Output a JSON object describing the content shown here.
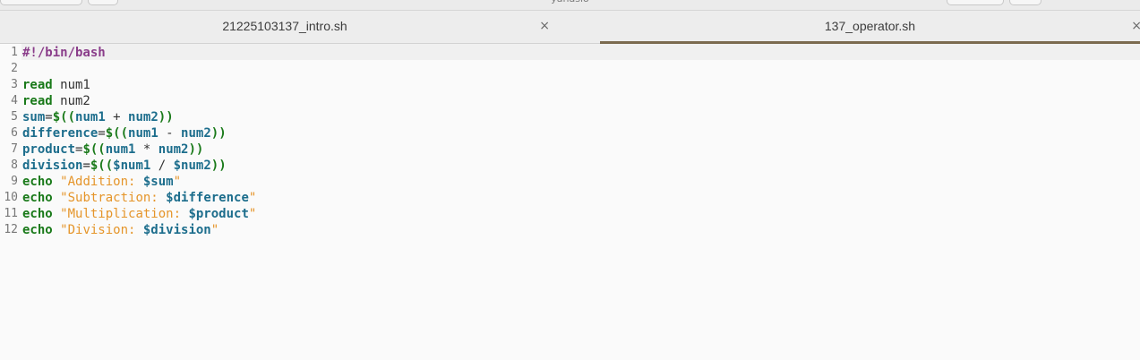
{
  "window": {
    "title": "yanasio"
  },
  "tabs": [
    {
      "label": "21225103137_intro.sh",
      "close": "×"
    },
    {
      "label": "137_operator.sh",
      "close": "×"
    }
  ],
  "colors": {
    "keyword": "#1a7a1a",
    "shebang": "#8a3d8a",
    "variable": "#1c6d8c",
    "string": "#e5952a",
    "active_tab_underline": "#7b6a4f"
  },
  "editor": {
    "line_numbers": [
      "1",
      "2",
      "3",
      "4",
      "5",
      "6",
      "7",
      "8",
      "9",
      "10",
      "11",
      "12"
    ],
    "lines": [
      [
        {
          "t": "shebang",
          "v": "#!/bin/bash"
        }
      ],
      [],
      [
        {
          "t": "kw",
          "v": "read"
        },
        {
          "t": "txt",
          "v": " num1"
        }
      ],
      [
        {
          "t": "kw",
          "v": "read"
        },
        {
          "t": "txt",
          "v": " num2"
        }
      ],
      [
        {
          "t": "var",
          "v": "sum"
        },
        {
          "t": "op",
          "v": "="
        },
        {
          "t": "paren",
          "v": "$(("
        },
        {
          "t": "var",
          "v": "num1"
        },
        {
          "t": "op",
          "v": " + "
        },
        {
          "t": "var",
          "v": "num2"
        },
        {
          "t": "paren",
          "v": "))"
        }
      ],
      [
        {
          "t": "var",
          "v": "difference"
        },
        {
          "t": "op",
          "v": "="
        },
        {
          "t": "paren",
          "v": "$(("
        },
        {
          "t": "var",
          "v": "num1"
        },
        {
          "t": "op",
          "v": " - "
        },
        {
          "t": "var",
          "v": "num2"
        },
        {
          "t": "paren",
          "v": "))"
        }
      ],
      [
        {
          "t": "var",
          "v": "product"
        },
        {
          "t": "op",
          "v": "="
        },
        {
          "t": "paren",
          "v": "$(("
        },
        {
          "t": "var",
          "v": "num1"
        },
        {
          "t": "op",
          "v": " * "
        },
        {
          "t": "var",
          "v": "num2"
        },
        {
          "t": "paren",
          "v": "))"
        }
      ],
      [
        {
          "t": "var",
          "v": "division"
        },
        {
          "t": "op",
          "v": "="
        },
        {
          "t": "paren",
          "v": "$(("
        },
        {
          "t": "var",
          "v": "$num1"
        },
        {
          "t": "op",
          "v": " / "
        },
        {
          "t": "var",
          "v": "$num2"
        },
        {
          "t": "paren",
          "v": "))"
        }
      ],
      [
        {
          "t": "kw",
          "v": "echo"
        },
        {
          "t": "txt",
          "v": " "
        },
        {
          "t": "str",
          "v": "\"Addition: "
        },
        {
          "t": "var",
          "v": "$sum"
        },
        {
          "t": "str",
          "v": "\""
        }
      ],
      [
        {
          "t": "kw",
          "v": "echo"
        },
        {
          "t": "txt",
          "v": " "
        },
        {
          "t": "str",
          "v": "\"Subtraction: "
        },
        {
          "t": "var",
          "v": "$difference"
        },
        {
          "t": "str",
          "v": "\""
        }
      ],
      [
        {
          "t": "kw",
          "v": "echo"
        },
        {
          "t": "txt",
          "v": " "
        },
        {
          "t": "str",
          "v": "\"Multiplication: "
        },
        {
          "t": "var",
          "v": "$product"
        },
        {
          "t": "str",
          "v": "\""
        }
      ],
      [
        {
          "t": "kw",
          "v": "echo"
        },
        {
          "t": "txt",
          "v": " "
        },
        {
          "t": "str",
          "v": "\"Division: "
        },
        {
          "t": "var",
          "v": "$division"
        },
        {
          "t": "str",
          "v": "\""
        }
      ]
    ]
  }
}
